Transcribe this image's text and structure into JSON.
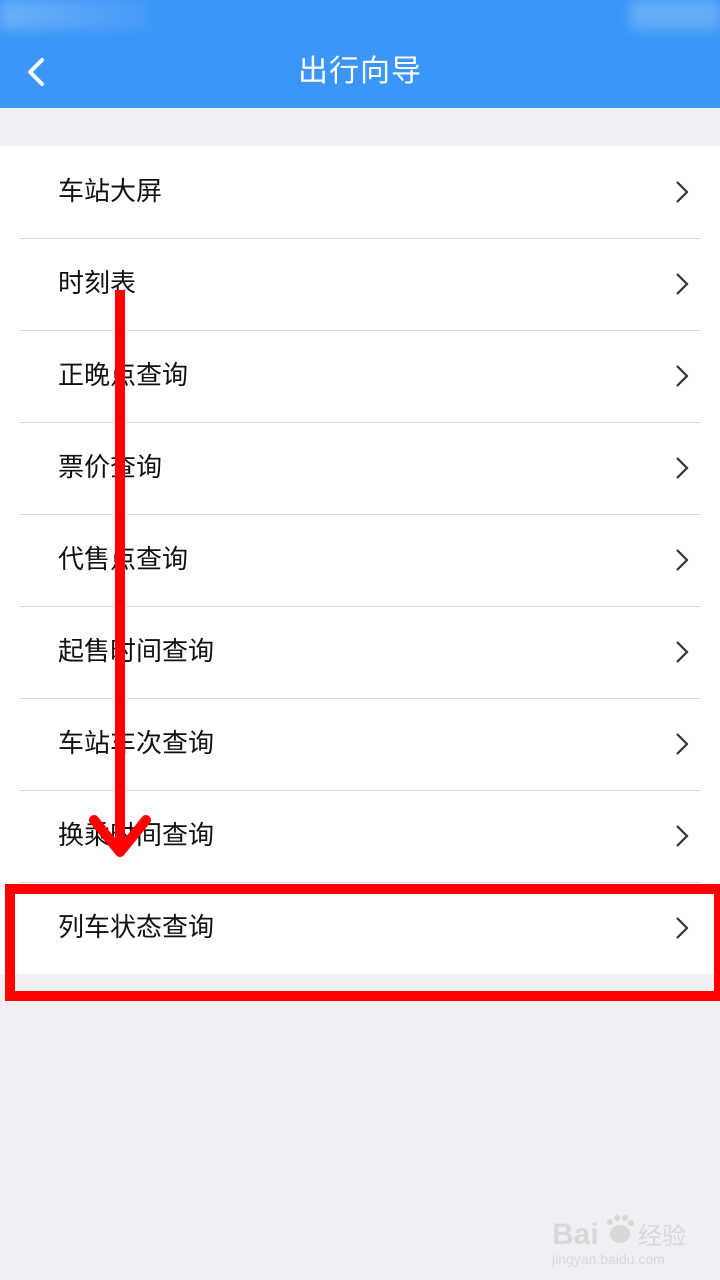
{
  "header": {
    "title": "出行向导",
    "back_icon": "chevron-left-icon",
    "background": "#3b96f7"
  },
  "menu": {
    "items": [
      {
        "label": "车站大屏"
      },
      {
        "label": "时刻表"
      },
      {
        "label": "正晚点查询"
      },
      {
        "label": "票价查询"
      },
      {
        "label": "代售点查询"
      },
      {
        "label": "起售时间查询"
      },
      {
        "label": "车站车次查询"
      },
      {
        "label": "换乘时间查询"
      },
      {
        "label": "列车状态查询"
      }
    ],
    "chevron_icon": "chevron-right-icon",
    "highlighted_label": "列车状态查询",
    "highlight_color": "#ff0000"
  },
  "watermark": {
    "brand": "Bai",
    "brand_cn": "经验",
    "url": "jingyan.baidu.com"
  }
}
